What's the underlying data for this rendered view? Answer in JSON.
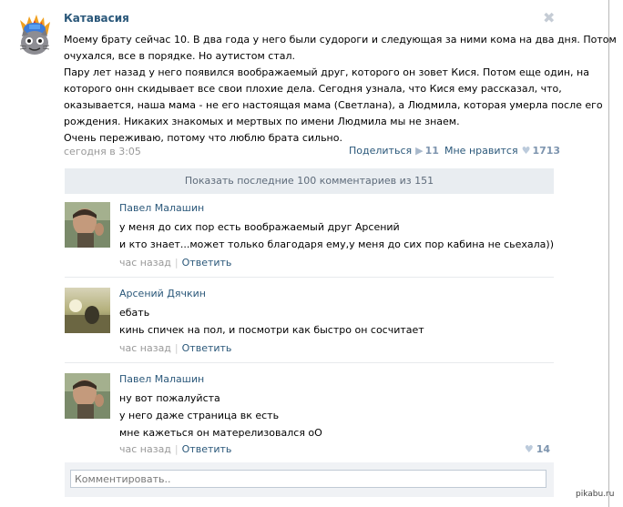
{
  "post": {
    "author": "Катавасия",
    "close_icon_char": "✖",
    "text_lines": [
      "Моему брату сейчас 10. В два года у него были судороги и следующая за ними кома на два дня. Потом",
      "очухался, все в порядке. Но аутистом стал.",
      "Пару лет назад у него появился воображаемый друг, которого он зовет Кися. Потом еще один, на",
      "которого онн скидывает все свои плохие дела. Сегодня узнала, что Кися ему рассказал, что,",
      "оказывается, наша мама - не его настоящая мама (Светлана), а Людмила, которая умерла после его",
      "рождения. Никаких знакомых и мертвых по имени Людмила мы не знаем.",
      "Очень переживаю, потому что люблю брата сильно."
    ],
    "time": "сегодня в 3:05",
    "share_label": "Поделиться",
    "share_count": "11",
    "like_label": "Мне нравится",
    "like_count": "1713"
  },
  "show_more": "Показать последние 100 комментариев из 151",
  "comments": [
    {
      "name": "Павел Малашин",
      "lines": [
        "у меня до сих пор есть воображаемый друг Арсений",
        "и кто знает...может только благодаря ему,у меня до сих пор кабина не сьехала))"
      ],
      "time": "час назад",
      "reply": "Ответить",
      "likes": ""
    },
    {
      "name": "Арсений Дячкин",
      "lines": [
        "ебать",
        "кинь спичек на пол, и посмотри как быстро он сосчитает"
      ],
      "time": "час назад",
      "reply": "Ответить",
      "likes": ""
    },
    {
      "name": "Павел Малашин",
      "lines": [
        "ну вот пожалуйста",
        "у него даже страница вк есть",
        "мне кажеться он матерелизовался оО"
      ],
      "time": "час назад",
      "reply": "Ответить",
      "likes": "14"
    }
  ],
  "comment_placeholder": "Комментировать..",
  "watermark": "pikabu.ru",
  "icons": {
    "close": "close-icon",
    "share": "megaphone-icon",
    "like": "heart-icon"
  }
}
